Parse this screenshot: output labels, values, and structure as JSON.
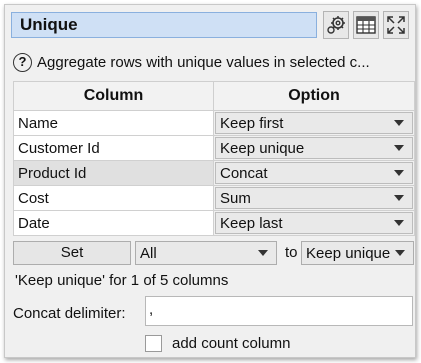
{
  "header": {
    "title": "Unique",
    "icons": [
      "gear-icon",
      "table-icon",
      "expand-icon"
    ]
  },
  "description": "Aggregate rows with unique values in selected c...",
  "table": {
    "headers": [
      "Column",
      "Option"
    ],
    "rows": [
      {
        "column": "Name",
        "option": "Keep first"
      },
      {
        "column": "Customer Id",
        "option": "Keep unique"
      },
      {
        "column": "Product Id",
        "option": "Concat"
      },
      {
        "column": "Cost",
        "option": "Sum"
      },
      {
        "column": "Date",
        "option": "Keep last"
      }
    ],
    "selected_row": 2
  },
  "set_row": {
    "set_label": "Set",
    "scope_value": "All",
    "to_label": "to",
    "option_value": "Keep unique"
  },
  "status": "'Keep unique' for 1 of 5 columns",
  "delimiter": {
    "label": "Concat delimiter:",
    "value": ","
  },
  "count_column": {
    "label": "add count column",
    "checked": false
  }
}
